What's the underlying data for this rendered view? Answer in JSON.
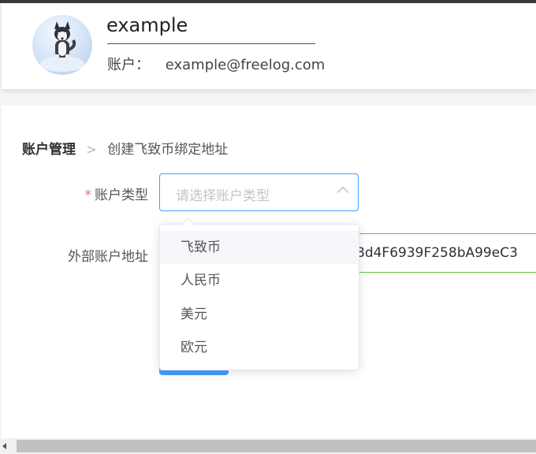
{
  "profile": {
    "username": "example",
    "account_label": "账户：",
    "account_email": "example@freelog.com"
  },
  "breadcrumb": {
    "first": "账户管理",
    "separator": ">",
    "current": "创建飞致币绑定地址"
  },
  "form": {
    "account_type": {
      "required_mark": "*",
      "label": "账户类型",
      "placeholder": "请选择账户类型"
    },
    "external_address": {
      "label": "外部账户地址",
      "visible_value": "8d4F6939F258bA99eC3"
    }
  },
  "dropdown": {
    "options": [
      "飞致币",
      "人民币",
      "美元",
      "欧元"
    ],
    "hovered_index": 0
  },
  "colors": {
    "accent": "#409eff",
    "success_border": "#67c23a",
    "required": "#f56c6c"
  },
  "icons": {
    "select_arrow": "chevron-up-icon",
    "breadcrumb_separator": "chevron-right-icon"
  }
}
